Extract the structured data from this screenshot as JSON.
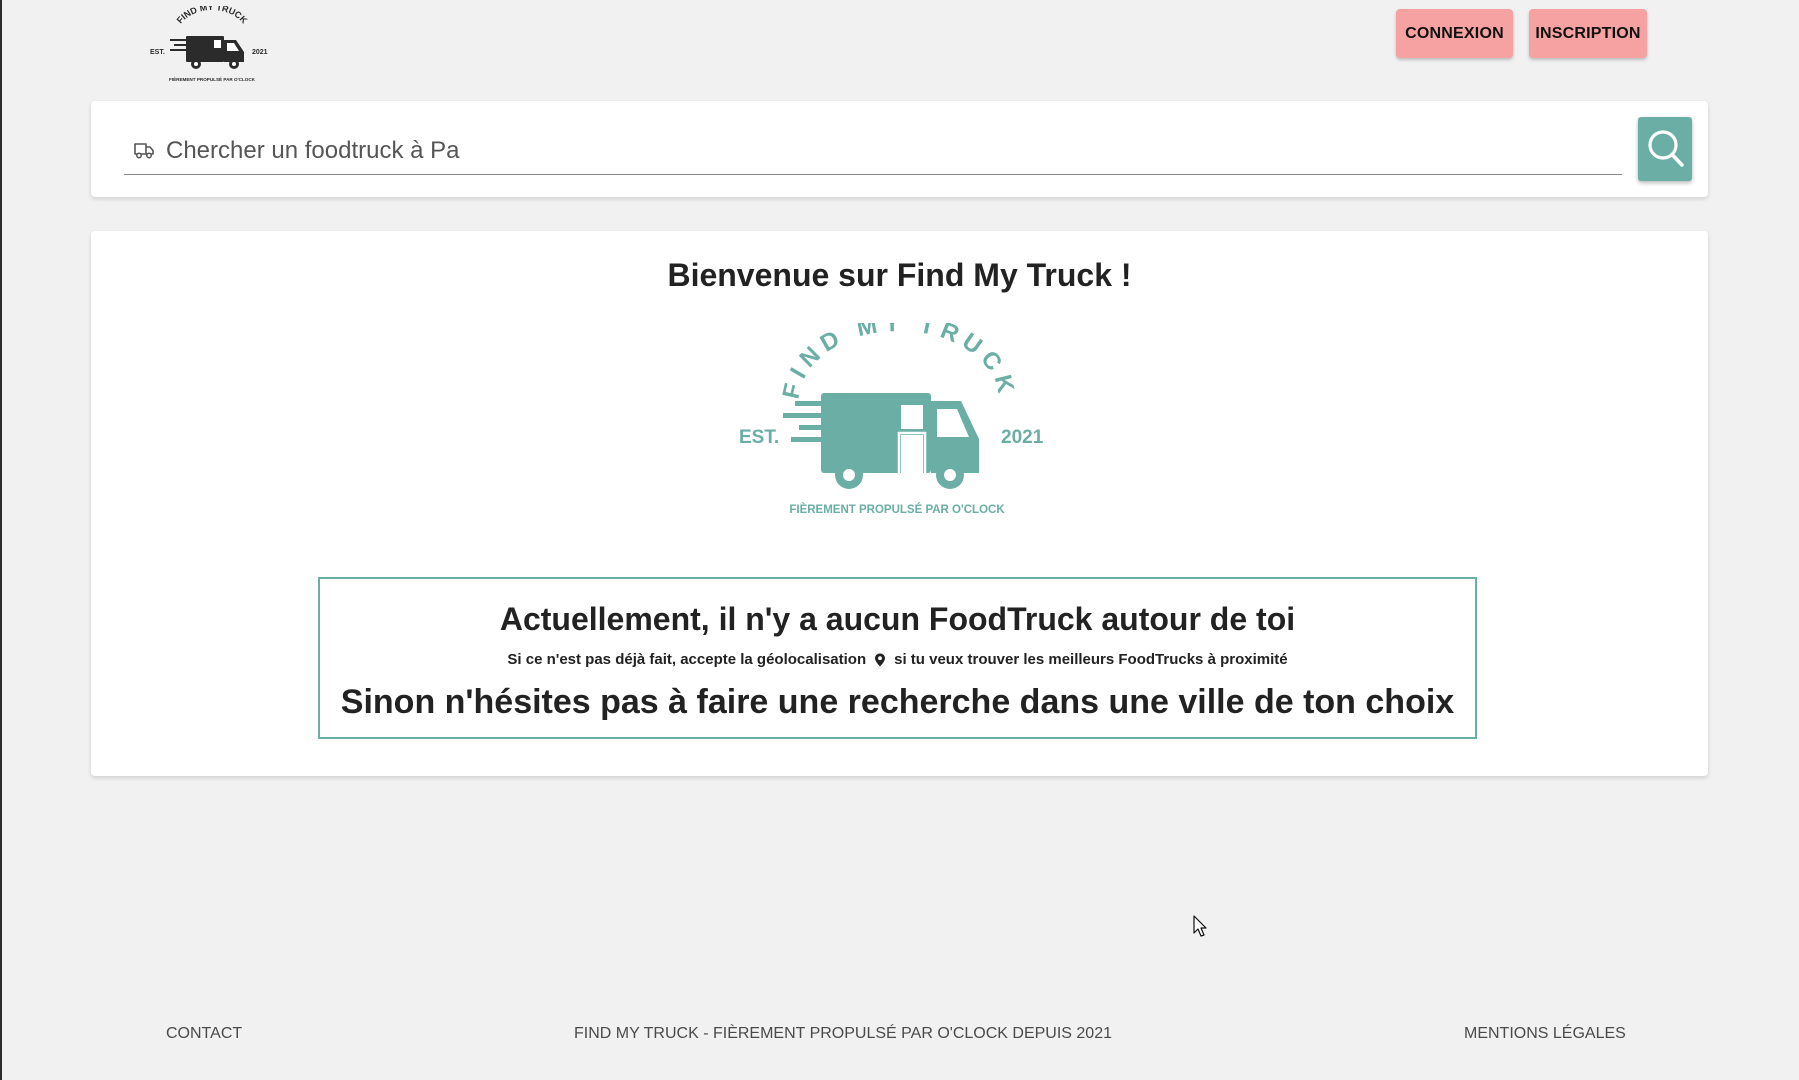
{
  "header": {
    "logo_alt": "FIND MY TRUCK",
    "login_label": "CONNEXION",
    "signup_label": "INSCRIPTION"
  },
  "search": {
    "value": "Chercher un foodtruck à Pa",
    "icon": "truck-icon",
    "button_icon": "search-icon"
  },
  "main": {
    "title": "Bienvenue sur Find My Truck !",
    "logo": {
      "top": "FIND MY TRUCK",
      "left": "EST.",
      "right": "2021",
      "bottom": "FIÈREMENT PROPULSÉ PAR O'CLOCK"
    },
    "notice": {
      "heading": "Actuellement, il n'y a aucun FoodTruck autour de toi",
      "sub_before": "Si ce n'est pas déjà fait, accepte la géolocalisation",
      "sub_icon": "location-pin-icon",
      "sub_after": "si tu veux trouver les meilleurs FoodTrucks à proximité",
      "alternative": "Sinon n'hésites pas à faire une recherche dans une ville de ton choix"
    }
  },
  "footer": {
    "contact": "CONTACT",
    "center": "FIND MY TRUCK - FIÈREMENT PROPULSÉ PAR O'CLOCK DEPUIS 2021",
    "legal": "MENTIONS LÉGALES"
  },
  "colors": {
    "page_background": "#f1f1f1",
    "auth_button": "#f6a2a2",
    "accent_teal": "#6aaea6",
    "logo_dark": "#2b2b2b"
  }
}
